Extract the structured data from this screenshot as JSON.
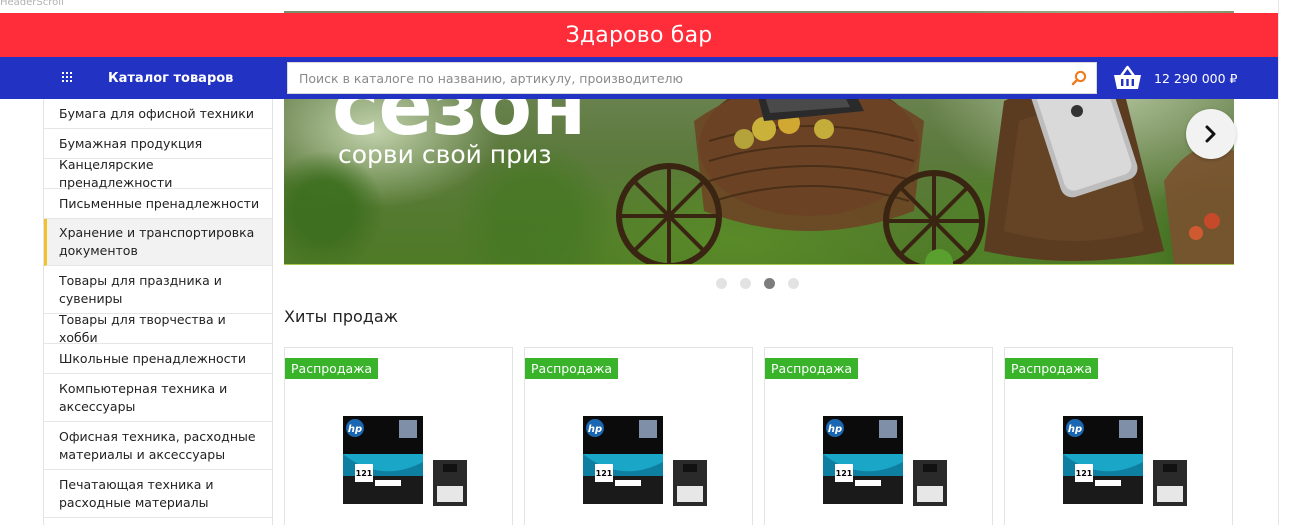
{
  "debug_label": "HeaderScroll",
  "top_bar": {
    "title": "Здарово бар"
  },
  "nav": {
    "catalog_label": "Каталог товаров",
    "catalog_icon": "grid-icon",
    "search_placeholder": "Поиск в каталоге по названию, артикулу, производителю",
    "search_value": "",
    "search_icon": "search-icon",
    "cart_icon": "basket-icon",
    "cart_sum": "12 290 000 ₽"
  },
  "hero": {
    "title": "сезон",
    "subtitle": "сорви свой приз",
    "next_icon": "chevron-right-icon",
    "slide_count": 4,
    "active_slide": 3
  },
  "sidebar": {
    "items": [
      {
        "label": "Бумага для офисной техники",
        "active": false
      },
      {
        "label": "Бумажная продукция",
        "active": false
      },
      {
        "label": "Канцелярские пренадлежности",
        "active": false
      },
      {
        "label": "Письменные пренадлежности",
        "active": false
      },
      {
        "label": "Хранение и транспортировка документов",
        "active": true
      },
      {
        "label": "Товары для праздника и сувениры",
        "active": false
      },
      {
        "label": "Товары для творчества и хобби",
        "active": false
      },
      {
        "label": "Школьные пренадлежности",
        "active": false
      },
      {
        "label": "Компьютерная техника и аксессуары",
        "active": false
      },
      {
        "label": "Офисная техника, расходные материалы и аксессуары",
        "active": false
      },
      {
        "label": "Печатающая техника и расходные материалы",
        "active": false
      }
    ]
  },
  "bestsellers": {
    "title": "Хиты продаж",
    "products": [
      {
        "badge": "Распродажа",
        "image": "hp-121-cartridge"
      },
      {
        "badge": "Распродажа",
        "image": "hp-121-cartridge"
      },
      {
        "badge": "Распродажа",
        "image": "hp-121-cartridge"
      },
      {
        "badge": "Распродажа",
        "image": "hp-121-cartridge"
      }
    ]
  },
  "colors": {
    "top_bar": "#ff2d3a",
    "nav_bar": "#2233c3",
    "badge": "#38b32a",
    "active_accent": "#f2c12e"
  }
}
